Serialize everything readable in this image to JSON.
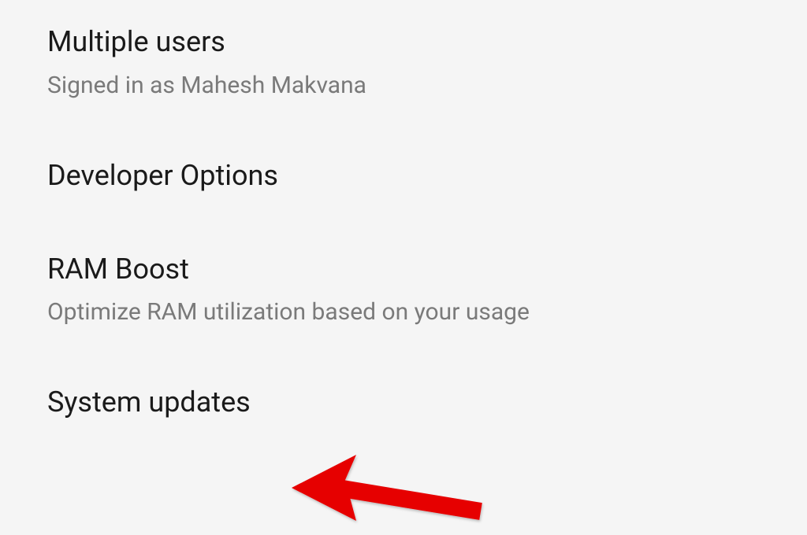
{
  "settings": {
    "items": [
      {
        "title": "Multiple users",
        "subtitle": "Signed in as Mahesh Makvana"
      },
      {
        "title": "Developer Options",
        "subtitle": null
      },
      {
        "title": "RAM Boost",
        "subtitle": "Optimize RAM utilization based on your usage"
      },
      {
        "title": "System updates",
        "subtitle": null
      }
    ]
  },
  "annotation": {
    "color": "#e60000"
  }
}
